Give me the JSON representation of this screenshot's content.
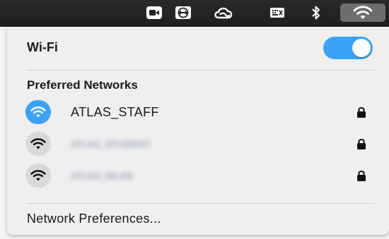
{
  "menubar": {
    "icons": [
      "video-camera-icon",
      "teamviewer-icon",
      "creative-cloud-icon",
      "keyboard-viewer-icon",
      "bluetooth-icon",
      "wifi-icon"
    ]
  },
  "wifi": {
    "title": "Wi-Fi",
    "enabled": true,
    "accent_color": "#3aa3f7"
  },
  "preferred": {
    "title": "Preferred Networks",
    "networks": [
      {
        "name": "ATLAS_STAFF",
        "connected": true,
        "locked": true
      },
      {
        "name": "ATLAS_STUDENT",
        "connected": false,
        "locked": true
      },
      {
        "name": "ATLAS_WLAN",
        "connected": false,
        "locked": true
      }
    ]
  },
  "footer": {
    "prefs_label": "Network Preferences..."
  }
}
